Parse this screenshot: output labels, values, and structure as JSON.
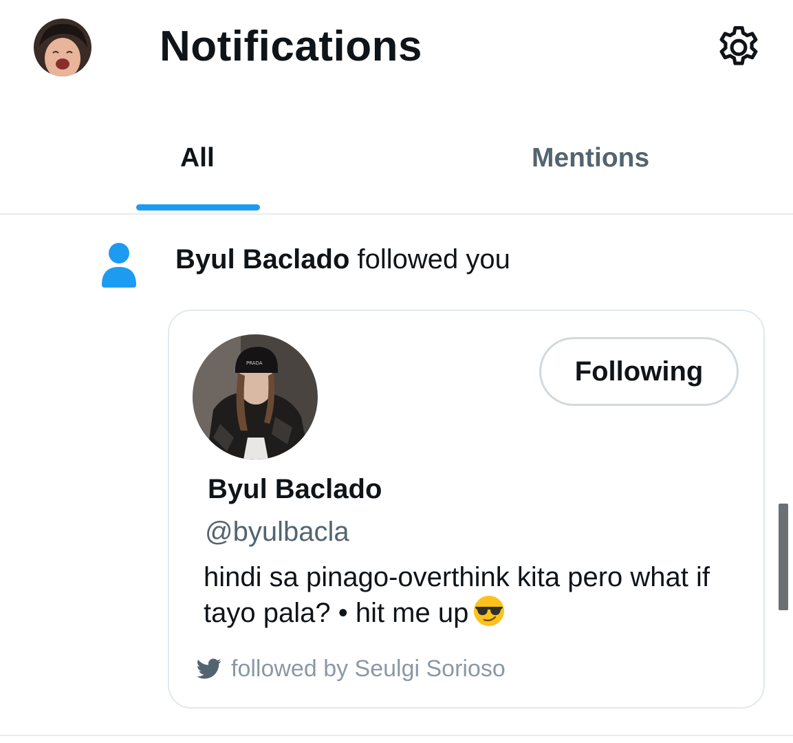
{
  "header": {
    "title": "Notifications",
    "avatar_icon": "user-avatar",
    "settings_icon": "gear-icon"
  },
  "tabs": [
    {
      "label": "All",
      "active": true
    },
    {
      "label": "Mentions",
      "active": false
    }
  ],
  "notification": {
    "icon": "person-icon",
    "user_name": "Byul Baclado",
    "action": "followed you",
    "card": {
      "name": "Byul Baclado",
      "handle": "@byulbacla",
      "bio": "hindi sa pinago-overthink kita pero what if tayo pala? • hit me up",
      "bio_emoji": "sunglasses-emoji",
      "follow_button_label": "Following",
      "followed_by_icon": "twitter-bird-icon",
      "followed_by": "followed by Seulgi Sorioso"
    }
  },
  "colors": {
    "accent": "#1d9bf0",
    "text_primary": "#0f1419",
    "text_secondary": "#536471",
    "border": "#e1e8ed"
  }
}
